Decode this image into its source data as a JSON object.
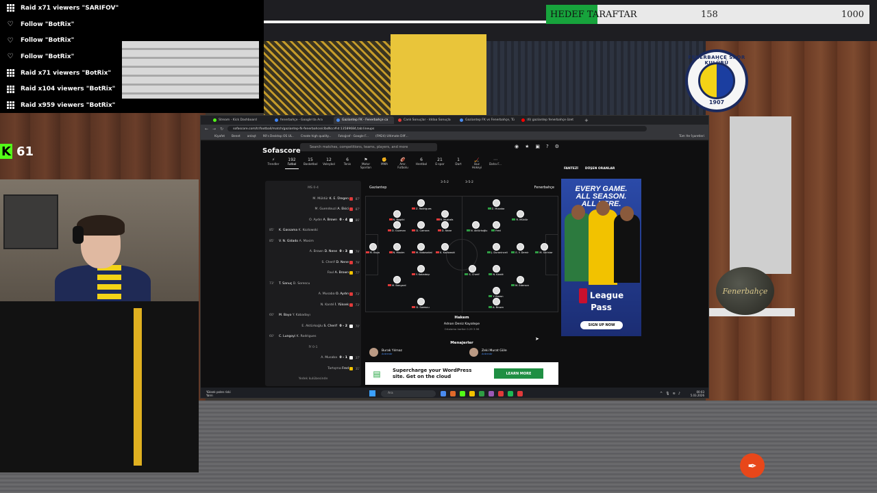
{
  "alerts": [
    {
      "icon": "raid-icon",
      "text": "Raid x71 viewers \"SARIFOV\""
    },
    {
      "icon": "heart-icon",
      "text": "Follow \"BotRix\""
    },
    {
      "icon": "heart-icon",
      "text": "Follow \"BotRix\""
    },
    {
      "icon": "heart-icon",
      "text": "Follow \"BotRix\""
    },
    {
      "icon": "raid-icon",
      "text": "Raid x71 viewers \"BotRix\""
    },
    {
      "icon": "raid-icon",
      "text": "Raid x104 viewers \"BotRix\""
    },
    {
      "icon": "raid-icon",
      "text": "Raid x959 viewers \"BotRix\""
    }
  ],
  "kick": {
    "logo": "K",
    "viewers": "61"
  },
  "goal": {
    "label": "HEDEF TARAFTAR",
    "current": "158",
    "target": "1000",
    "progress": 0.158,
    "color": "#17a33c"
  },
  "club_badge": {
    "ring_text": "FENERBAHÇE SPOR KULÜBÜ",
    "year": "1907"
  },
  "ball_text": "Fenerbahçe",
  "browser": {
    "tabs": [
      {
        "label": "Stream - Kick Dashboard",
        "color": "#53fc18"
      },
      {
        "label": "fenerbahçe - Google'da Ara",
        "color": "#4285f4"
      },
      {
        "label": "Gaziantep FK - Fenerbahçe ca",
        "color": "#4a8cf0",
        "active": true
      },
      {
        "label": "Canlı Sonuçlar - Iddaa Sonuçla",
        "color": "#e03a3a"
      },
      {
        "label": "Gaziantep FK vs Fenerbahçe, Tü",
        "color": "#4a8cf0"
      },
      {
        "label": "(6) gaziantep fenerbahçe özet",
        "color": "#ff0000"
      }
    ],
    "url": "sofascore.com/tr/football/match/gaziantep-fk-fenerbahce/clbsNcc#id:13589684,tab:lineups",
    "bookmarks": [
      "Kiyafet",
      "Benet",
      "anlaşt",
      "90's Desktop OS UL..",
      "Create high quality...",
      "Fotoğraf - Google F...",
      "(FM24) Ultimate Diff..."
    ],
    "bookmarks_right": "Tüm Yer İşaretleri"
  },
  "sofascore": {
    "logo": "Sofascore",
    "search_placeholder": "Search matches, competitions, teams, players, and more",
    "nav": [
      {
        "label": "Trendler",
        "badge": "⚡"
      },
      {
        "label": "Futbol",
        "badge": "192",
        "active": true
      },
      {
        "label": "Basketbol",
        "badge": "15"
      },
      {
        "label": "Voleybol",
        "badge": "12"
      },
      {
        "label": "Tenis",
        "badge": "6"
      },
      {
        "label": "Motor Sporları",
        "badge": "⚑"
      },
      {
        "label": "MMA",
        "badge": "✊"
      },
      {
        "label": "Amr. Futbolu",
        "badge": "🏈"
      },
      {
        "label": "Hentbol",
        "badge": "6"
      },
      {
        "label": "E-spor",
        "badge": "21"
      },
      {
        "label": "Dart",
        "badge": "1"
      },
      {
        "label": "Buz Hokeyi",
        "badge": "🏒"
      },
      {
        "label": "Daha F...",
        "badge": "⋯"
      }
    ],
    "right_nav": [
      "FANTEZİ",
      "DÜŞEN ORANLAR"
    ],
    "events": [
      {
        "min": "",
        "text": "MS 0-4",
        "center": true
      },
      {
        "min": "",
        "text": "M. Müldür",
        "sub": "K. E. Üregen",
        "ic": "#e03a3a",
        "min_r": "87'"
      },
      {
        "min": "",
        "text": "M. Guendouzi",
        "sub": "A. Ekici",
        "ic": "#e03a3a",
        "min_r": "87'"
      },
      {
        "min": "",
        "text": "O. Aydın",
        "sub": "A. Brown",
        "score": "0 - 4",
        "ic": "#fff",
        "min_r": "86'"
      },
      {
        "min": "85'",
        "text": "K. Gassama",
        "sub": "K. Kozlowski",
        "left": true
      },
      {
        "min": "85'",
        "text": "V. N. Gidado",
        "sub": "A. Maxim",
        "left": true
      },
      {
        "min": "",
        "text": "A. Brown",
        "sub": "D. Nene",
        "score": "0 - 3",
        "ic": "#fff",
        "min_r": "79'"
      },
      {
        "min": "",
        "text": "S. Cherif",
        "sub": "D. Nene",
        "ic": "#e03a3a",
        "min_r": "79'"
      },
      {
        "min": "",
        "text": "Faul",
        "sub": "A. Brown",
        "ic": "#f2c200",
        "min_r": "77'"
      },
      {
        "min": "73'",
        "text": "T. Sanuç",
        "sub": "D. Sorescu",
        "left": true
      },
      {
        "min": "",
        "text": "A. Musaba",
        "sub": "O. Aydın",
        "ic": "#e03a3a",
        "min_r": "73'"
      },
      {
        "min": "",
        "text": "N. Kanté",
        "sub": "İ. Yüksek",
        "ic": "#e03a3a",
        "min_r": "73'"
      },
      {
        "min": "60'",
        "text": "M. Bayo",
        "sub": "Y. Kabadayı",
        "left": true
      },
      {
        "min": "",
        "text": "E. Aktürkoğlu",
        "sub": "S. Cherif",
        "score": "0 - 2",
        "ic": "#fff",
        "min_r": "70'"
      },
      {
        "min": "60'",
        "text": "C. Lungoyi",
        "sub": "K. Rodrigues",
        "left": true
      },
      {
        "min": "",
        "text": "İY 0-1",
        "center": true
      },
      {
        "min": "",
        "text": "A. Musaba",
        "score": "0 - 1",
        "ic": "#fff",
        "min_r": "37'"
      },
      {
        "min": "",
        "text": "Tartışma",
        "sub": "Fred",
        "ic": "#f2c200",
        "min_r": "31'"
      },
      {
        "min": "",
        "text": "Yedek kulübesinde",
        "center": true
      }
    ],
    "home_team": "Gaziantep",
    "away_team": "Fenerbahçe",
    "home_form": "3-5-2",
    "away_form": "3-5-2",
    "home_players": [
      {
        "name": "Z. Rodrigues"
      },
      {
        "name": "N. Bagılki"
      },
      {
        "name": "R. Mustafa"
      },
      {
        "name": "D. Camara"
      },
      {
        "name": "D. Nane"
      },
      {
        "name": "D. Guzman"
      },
      {
        "name": "M. Bayo"
      },
      {
        "name": "N. Maxim"
      },
      {
        "name": "M. Kabasakal"
      },
      {
        "name": "K. Kozlowski"
      },
      {
        "name": "Y. Kabadayı"
      },
      {
        "name": "M. Bangard"
      },
      {
        "name": "D. Sorescu"
      }
    ],
    "away_players": [
      {
        "name": "Z. Musaba"
      },
      {
        "name": "R. Müldür"
      },
      {
        "name": "N. Aktürkoğlu"
      },
      {
        "name": "Fred"
      },
      {
        "name": "J. Duraninceli"
      },
      {
        "name": "E. Y. Demir"
      },
      {
        "name": "M. Skriniar"
      },
      {
        "name": "S. Cherif"
      },
      {
        "name": "N. Kanté"
      },
      {
        "name": "Y. Brown"
      },
      {
        "name": "M. Ederson"
      },
      {
        "name": "A. Brown"
      }
    ],
    "referee": {
      "title": "Hakem",
      "name": "Adnan Deniz Kayatepe",
      "stats": "Ortalama kartlar 0.29 3.96"
    },
    "managers_title": "Menajerler",
    "managers": [
      {
        "name": "Burak Yılmaz",
        "role": "Antrenör"
      },
      {
        "name": "Zeki Murat Göle",
        "role": "Antrenör"
      }
    ],
    "wp_ad": {
      "text": "Supercharge your WordPress site. Get on the cloud",
      "button": "LEARN MORE"
    },
    "nba_ad": {
      "headline1": "EVERY GAME.",
      "headline2": "ALL SEASON.",
      "headline3": "ALL HERE.",
      "brand1": "League",
      "brand2": "Pass",
      "cta": "SIGN UP NOW"
    }
  },
  "taskbar": {
    "weather": "Yüksek polen riski",
    "weather_sub": "Yarın",
    "search": "Ara",
    "time": "00:03",
    "date": "5.03.2026",
    "app_colors": [
      "#4a8cf0",
      "#e06a2a",
      "#53fc18",
      "#f2c200",
      "#2f9e44",
      "#9b59b6",
      "#e03a3a",
      "#1db954",
      "#e03a3a"
    ]
  }
}
